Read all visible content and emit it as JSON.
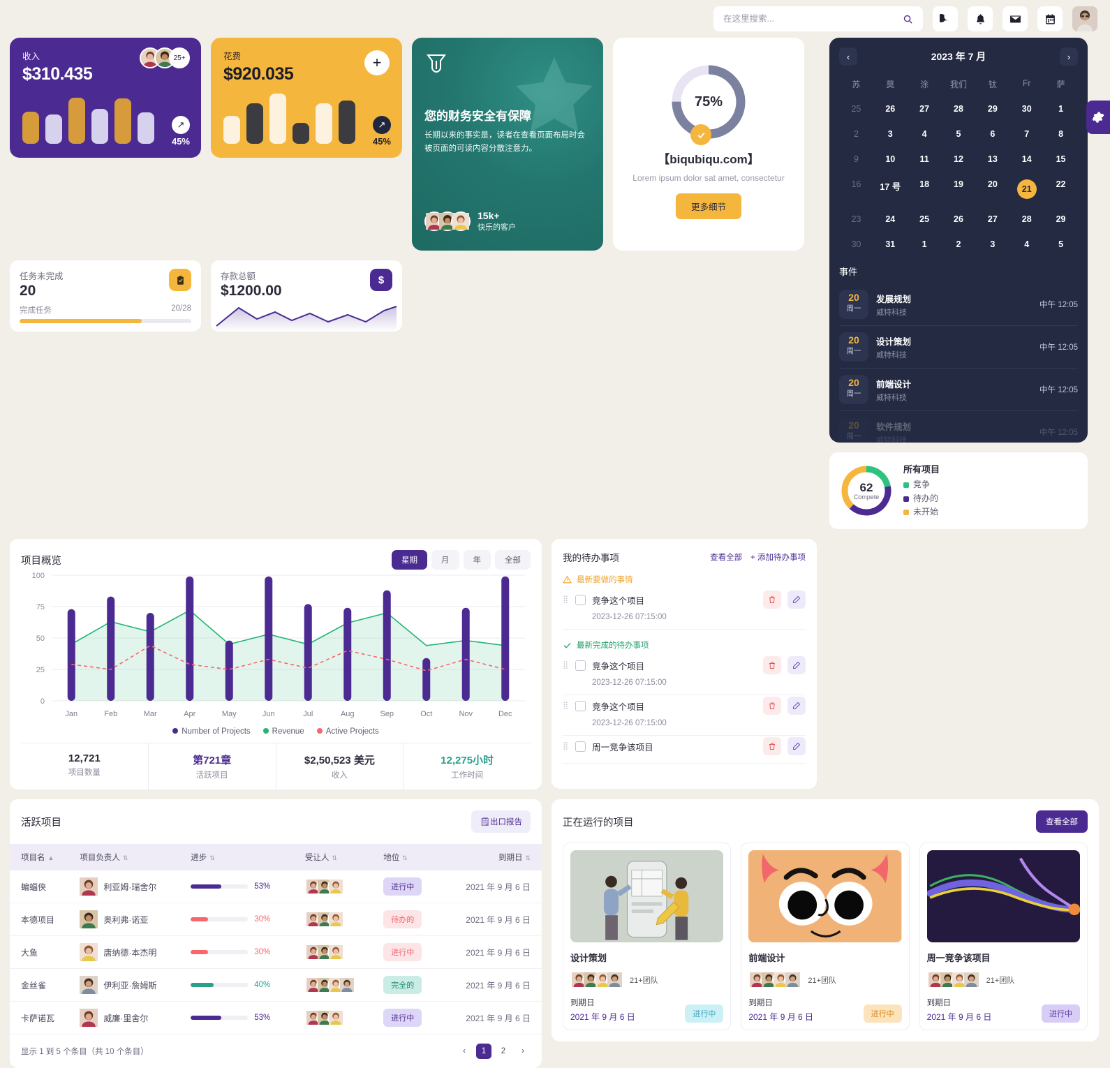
{
  "header": {
    "search_placeholder": "在这里搜索...",
    "search_value": "",
    "icons": {
      "search": "search-icon",
      "dark_mode": "moon-icon",
      "notifications": "bell-icon",
      "mail": "mail-icon",
      "calendar": "calendar-icon",
      "profile": "avatar"
    },
    "settings_tab": "gear-icon"
  },
  "stat_cards": [
    {
      "label": "收入",
      "value": "$310.435",
      "pct": "45%",
      "avatar_more": "25+",
      "theme": "purple"
    },
    {
      "label": "花费",
      "value": "$920.035",
      "pct": "45%",
      "add_label": "+",
      "theme": "yellow"
    }
  ],
  "small_cards": [
    {
      "label": "任务未完成",
      "value": "20",
      "foot_left": "完成任务",
      "foot_right": "20/28",
      "progress": 71,
      "icon": "clipboard-check-icon"
    },
    {
      "label": "存款总额",
      "value": "$1200.00",
      "icon": "dollar-icon"
    }
  ],
  "promo": {
    "title": "您的财务安全有保障",
    "body": "长期以来的事实是，读者在查看页面布局时会被页面的可读内容分散注意力。",
    "count": "15k+",
    "count_label": "快乐的客户",
    "logo": "shield-logo-icon"
  },
  "progress_card": {
    "percent": "75%",
    "percent_value": 75,
    "name": "【biqubiqu.com】",
    "subtitle": "Lorem ipsum dolor sat amet, consectetur",
    "button": "更多细节",
    "check_icon": "check-icon"
  },
  "calendar": {
    "title": "2023 年 7 月",
    "prev": "‹",
    "next": "›",
    "dow": [
      "苏",
      "莫",
      "涂",
      "我们",
      "钛",
      "Fr",
      "萨"
    ],
    "weeks": [
      [
        {
          "d": "25",
          "m": true
        },
        {
          "d": "26"
        },
        {
          "d": "27"
        },
        {
          "d": "28"
        },
        {
          "d": "29"
        },
        {
          "d": "30"
        },
        {
          "d": "1"
        }
      ],
      [
        {
          "d": "2",
          "m": true
        },
        {
          "d": "3"
        },
        {
          "d": "4"
        },
        {
          "d": "5"
        },
        {
          "d": "6"
        },
        {
          "d": "7"
        },
        {
          "d": "8"
        }
      ],
      [
        {
          "d": "9",
          "m": true
        },
        {
          "d": "10"
        },
        {
          "d": "11"
        },
        {
          "d": "12"
        },
        {
          "d": "13"
        },
        {
          "d": "14"
        },
        {
          "d": "15"
        }
      ],
      [
        {
          "d": "16",
          "m": true
        },
        {
          "d": "17 号"
        },
        {
          "d": "18"
        },
        {
          "d": "19"
        },
        {
          "d": "20"
        },
        {
          "d": "21",
          "sel": true
        },
        {
          "d": "22"
        }
      ],
      [
        {
          "d": "23",
          "m": true
        },
        {
          "d": "24"
        },
        {
          "d": "25"
        },
        {
          "d": "26"
        },
        {
          "d": "27"
        },
        {
          "d": "28"
        },
        {
          "d": "29"
        }
      ],
      [
        {
          "d": "30",
          "m": true
        },
        {
          "d": "31"
        },
        {
          "d": "1"
        },
        {
          "d": "2"
        },
        {
          "d": "3"
        },
        {
          "d": "4"
        },
        {
          "d": "5"
        }
      ]
    ],
    "events_title": "事件",
    "events": [
      {
        "day": "20",
        "weekday": "周一",
        "name": "发展规划",
        "company": "威特科技",
        "time": "中午 12:05"
      },
      {
        "day": "20",
        "weekday": "周一",
        "name": "设计策划",
        "company": "威特科技",
        "time": "中午 12:05"
      },
      {
        "day": "20",
        "weekday": "周一",
        "name": "前端设计",
        "company": "威特科技",
        "time": "中午 12:05"
      },
      {
        "day": "20",
        "weekday": "周一",
        "name": "软件规划",
        "company": "威特科技",
        "time": "中午 12:05"
      }
    ]
  },
  "chart_card": {
    "title": "项目概览",
    "segments": [
      {
        "label": "星期",
        "active": true
      },
      {
        "label": "月",
        "active": false
      },
      {
        "label": "年",
        "active": false
      },
      {
        "label": "全部",
        "active": false
      }
    ],
    "stats": [
      {
        "value": "12,721",
        "label": "项目数量",
        "color": "#2b2b3a"
      },
      {
        "value": "第721章",
        "label": "活跃项目",
        "color": "#4b2a91"
      },
      {
        "value": "$2,50,523 美元",
        "label": "收入",
        "color": "#2b2b3a"
      },
      {
        "value": "12,275小时",
        "label": "工作时间",
        "color": "#2aa08a"
      }
    ]
  },
  "chart_data": {
    "type": "bar",
    "title": "项目概览",
    "xlabel": "",
    "ylabel": "",
    "ylim": [
      0,
      100
    ],
    "yticks": [
      0,
      25,
      50,
      75,
      100
    ],
    "grid": true,
    "legend_position": "bottom",
    "categories": [
      "Jan",
      "Feb",
      "Mar",
      "Apr",
      "May",
      "Jun",
      "Jul",
      "Aug",
      "Sep",
      "Oct",
      "Nov",
      "Dec"
    ],
    "series": [
      {
        "name": "Number of Projects",
        "type": "bar",
        "color": "#4b2a91",
        "values": [
          73,
          83,
          70,
          99,
          48,
          99,
          77,
          74,
          88,
          34,
          74,
          99
        ]
      },
      {
        "name": "Revenue",
        "type": "area",
        "color": "#22b573",
        "values": [
          45,
          63,
          55,
          72,
          45,
          53,
          45,
          62,
          70,
          44,
          48,
          44
        ]
      },
      {
        "name": "Active Projects",
        "type": "line-dashed",
        "color": "#f9656b",
        "values": [
          29,
          25,
          44,
          29,
          25,
          33,
          26,
          40,
          33,
          24,
          33,
          25
        ]
      }
    ]
  },
  "todo": {
    "title": "我的待办事项",
    "view_all": "查看全部",
    "add": "+ 添加待办事项",
    "sections": [
      {
        "label": "最新要做的事情",
        "kind": "warn",
        "icon": "warning-icon"
      },
      {
        "label": "最新完成的待办事项",
        "kind": "done",
        "icon": "check-icon"
      }
    ],
    "items": [
      {
        "section": "最新要做的事情",
        "text": "竞争这个项目",
        "date": "2023-12-26 07:15:00",
        "checked": false
      },
      {
        "section": "最新完成的待办事项",
        "text": "竞争这个项目",
        "date": "2023-12-26 07:15:00",
        "checked": false
      },
      {
        "section": "",
        "text": "竞争这个项目",
        "date": "2023-12-26 07:15:00",
        "checked": false
      },
      {
        "section": "",
        "text": "周一竞争该项目",
        "date": "",
        "checked": false
      }
    ],
    "delete_icon": "trash-icon",
    "edit_icon": "pencil-icon"
  },
  "all_projects": {
    "title": "所有项目",
    "center_value": "62",
    "center_label": "Compete",
    "legend": [
      {
        "label": "竞争",
        "color": "#2ec17f",
        "value": 22
      },
      {
        "label": "待办的",
        "color": "#4b2a91",
        "value": 40
      },
      {
        "label": "未开始",
        "color": "#f5b63d",
        "value": 38
      }
    ]
  },
  "active_projects": {
    "title": "活跃项目",
    "export_label": "出口报告",
    "export_icon": "file-export-icon",
    "columns": [
      "项目名",
      "项目负责人",
      "进步",
      "受让人",
      "地位",
      "到期日"
    ],
    "rows": [
      {
        "name": "蝙蝠侠",
        "owner": "利亚姆·瑞舍尔",
        "progress": 53,
        "progress_label": "53%",
        "progress_color": "#4b2a91",
        "status": "进行中",
        "status_bg": "#ded6f7",
        "status_fg": "#4b2a91",
        "due": "2021 年 9 月 6 日",
        "team": 3
      },
      {
        "name": "本德项目",
        "owner": "奥利弗·诺亚",
        "progress": 30,
        "progress_label": "30%",
        "progress_color": "#f9656b",
        "status": "待办的",
        "status_bg": "#fde4e6",
        "status_fg": "#f06a70",
        "due": "2021 年 9 月 6 日",
        "team": 3
      },
      {
        "name": "大鱼",
        "owner": "唐纳德·本杰明",
        "progress": 30,
        "progress_label": "30%",
        "progress_color": "#f9656b",
        "status": "进行中",
        "status_bg": "#fde4e6",
        "status_fg": "#f06a70",
        "due": "2021 年 9 月 6 日",
        "team": 3
      },
      {
        "name": "金丝雀",
        "owner": "伊利亚·詹姆斯",
        "progress": 40,
        "progress_label": "40%",
        "progress_color": "#2aa08a",
        "status": "完全的",
        "status_bg": "#c9ece4",
        "status_fg": "#1d8b76",
        "due": "2021 年 9 月 6 日",
        "team": 4
      },
      {
        "name": "卡萨诺瓦",
        "owner": "威廉·里舍尔",
        "progress": 53,
        "progress_label": "53%",
        "progress_color": "#4b2a91",
        "status": "进行中",
        "status_bg": "#ded6f7",
        "status_fg": "#4b2a91",
        "due": "2021 年 9 月 6 日",
        "team": 3
      }
    ],
    "footer": "显示 1 到 5 个条目（共 10 个条目）",
    "pages": [
      "1",
      "2"
    ],
    "current_page": "1"
  },
  "running_projects": {
    "title": "正在运行的项目",
    "view_all": "查看全部",
    "cards": [
      {
        "name": "设计策划",
        "team_label": "21+团队",
        "due_label": "到期日",
        "due": "2021 年 9 月 6 日",
        "status": "进行中",
        "status_bg": "#ccf0f5",
        "status_fg": "#3aa9bd",
        "thumb": "wireframe-illustration"
      },
      {
        "name": "前端设计",
        "team_label": "21+团队",
        "due_label": "到期日",
        "due": "2021 年 9 月 6 日",
        "status": "进行中",
        "status_bg": "#fde3bb",
        "status_fg": "#d98716",
        "thumb": "cartoon-face-illustration"
      },
      {
        "name": "周一竞争该项目",
        "team_label": "21+团队",
        "due_label": "到期日",
        "due": "2021 年 9 月 6 日",
        "status": "进行中",
        "status_bg": "#d8cdf5",
        "status_fg": "#5b3cab",
        "thumb": "abstract-waves-illustration"
      }
    ]
  },
  "theme": {
    "bg": "#f2efe9",
    "purple": "#4b2a91",
    "yellow": "#f5b63d",
    "teal": "#23766e",
    "green": "#22b573",
    "red": "#f9656b",
    "dark": "#232a42"
  }
}
